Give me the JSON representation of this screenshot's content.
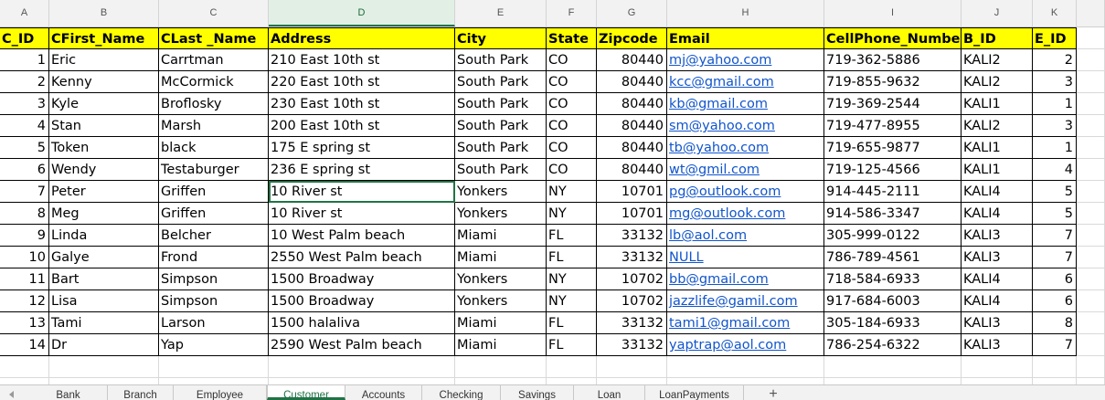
{
  "column_letters": [
    "A",
    "B",
    "C",
    "D",
    "E",
    "F",
    "G",
    "H",
    "I",
    "J",
    "K"
  ],
  "selected_column": "D",
  "table": {
    "headers": [
      "C_ID",
      "CFirst_Name",
      "CLast _Name",
      "Address",
      "City",
      "State",
      "Zipcode",
      "Email",
      "CellPhone_Number",
      "B_ID",
      "E_ID"
    ],
    "rows": [
      [
        "1",
        "Eric",
        "Carrtman",
        "210 East 10th st",
        "South Park",
        "CO",
        "80440",
        "mj@yahoo.com",
        "719-362-5886",
        "KALI2",
        "2"
      ],
      [
        "2",
        "Kenny",
        "McCormick",
        "220 East 10th st",
        "South Park",
        "CO",
        "80440",
        "kcc@gmail.com",
        "719-855-9632",
        "KALI2",
        "3"
      ],
      [
        "3",
        "Kyle",
        "Broflosky",
        "230 East 10th st",
        "South Park",
        "CO",
        "80440",
        "kb@gmail.com",
        "719-369-2544",
        "KALI1",
        "1"
      ],
      [
        "4",
        "Stan",
        "Marsh",
        "200 East 10th st",
        "South Park",
        "CO",
        "80440",
        "sm@yahoo.com",
        "719-477-8955",
        "KALI2",
        "3"
      ],
      [
        "5",
        "Token",
        "black",
        "175 E spring st",
        "South Park",
        "CO",
        "80440",
        "tb@yahoo.com",
        "719-655-9877",
        "KALI1",
        "1"
      ],
      [
        "6",
        "Wendy",
        "Testaburger",
        "236 E spring st",
        "South Park",
        "CO",
        "80440",
        "wt@gmil.com",
        "719-125-4566",
        "KALI1",
        "4"
      ],
      [
        "7",
        "Peter",
        "Griffen",
        "10 River st",
        "Yonkers",
        "NY",
        "10701",
        "pg@outlook.com",
        "914-445-2111",
        "KALI4",
        "5"
      ],
      [
        "8",
        "Meg",
        "Griffen",
        "10 River st",
        "Yonkers",
        "NY",
        "10701",
        "mg@outlook.com",
        "914-586-3347",
        "KALI4",
        "5"
      ],
      [
        "9",
        "Linda",
        "Belcher",
        "10 West Palm beach",
        "Miami",
        "FL",
        "33132",
        "lb@aol.com",
        "305-999-0122",
        "KALI3",
        "7"
      ],
      [
        "10",
        "Galye",
        "Frond",
        "2550 West Palm beach",
        "Miami",
        "FL",
        "33132",
        "NULL",
        "786-789-4561",
        "KALI3",
        "7"
      ],
      [
        "11",
        "Bart",
        "Simpson",
        "1500 Broadway",
        "Yonkers",
        "NY",
        "10702",
        "bb@gmail.com",
        "718-584-6933",
        "KALI4",
        "6"
      ],
      [
        "12",
        "Lisa",
        "Simpson",
        "1500 Broadway",
        "Yonkers",
        "NY",
        "10702",
        "jazzlife@gamil.com",
        "917-684-6003",
        "KALI4",
        "6"
      ],
      [
        "13",
        "Tami",
        "Larson",
        "1500 halaliva",
        "Miami",
        "FL",
        "33132",
        "tami1@gmail.com",
        "305-184-6933",
        "KALI3",
        "8"
      ],
      [
        "14",
        "Dr",
        "Yap",
        "2590 West Palm beach",
        "Miami",
        "FL",
        "33132",
        "yaptrap@aol.com",
        "786-254-6322",
        "KALI3",
        "7"
      ]
    ]
  },
  "active_cell": "D8",
  "sheet_tabs": [
    "Bank",
    "Branch",
    "Employee",
    "Customer",
    "Accounts",
    "Checking",
    "Savings",
    "Loan",
    "LoanPayments"
  ],
  "active_tab": "Customer",
  "add_sheet_label": "+",
  "colors": {
    "header_fill": "#ffff00",
    "link": "#1155cc",
    "accent": "#217346"
  },
  "icons": {
    "add_sheet": "plus-icon",
    "scroll_left": "triangle-left-icon"
  }
}
